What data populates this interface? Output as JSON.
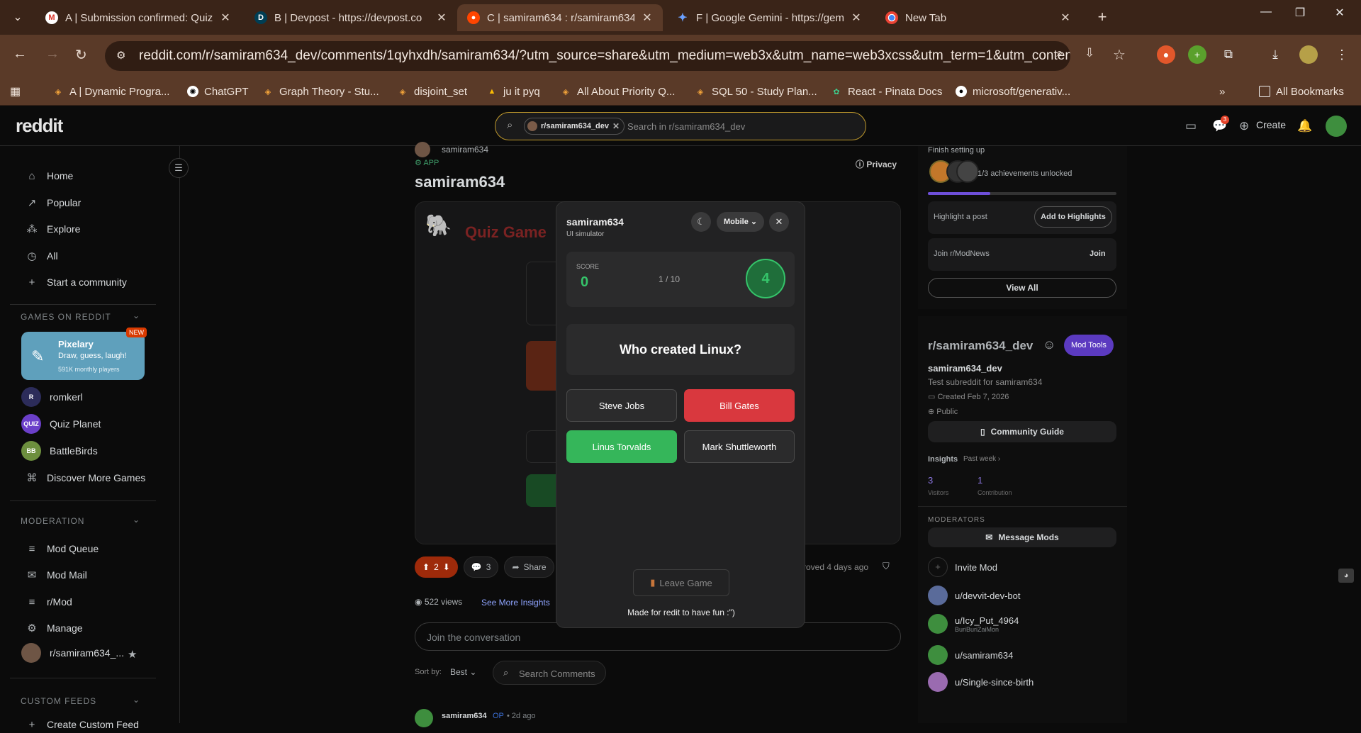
{
  "browser": {
    "tabs": [
      {
        "label": "A | Submission confirmed: Quiz",
        "icon": "gmail-icon"
      },
      {
        "label": "B | Devpost - https://devpost.co",
        "icon": "devpost-icon"
      },
      {
        "label": "C | samiram634 : r/samiram634",
        "icon": "reddit-icon"
      },
      {
        "label": "F | Google Gemini - https://gem",
        "icon": "gemini-icon"
      },
      {
        "label": "New Tab",
        "icon": "chrome-icon"
      }
    ],
    "url": "reddit.com/r/samiram634_dev/comments/1qyhxdh/samiram634/?utm_source=share&utm_medium=web3x&utm_name=web3xcss&utm_term=1&utm_content=sh...",
    "bookmarks": [
      "A | Dynamic Progra...",
      "ChatGPT",
      "Graph Theory - Stu...",
      "disjoint_set",
      "ju it pyq",
      "All About Priority Q...",
      "SQL 50 - Study Plan...",
      "React - Pinata Docs",
      "microsoft/generativ..."
    ],
    "all_bookmarks": "All Bookmarks"
  },
  "reddit": {
    "logo": "reddit",
    "search": {
      "chip": "r/samiram634_dev",
      "placeholder": "Search in r/samiram634_dev"
    },
    "create": "Create",
    "chat_badge": "3"
  },
  "left_nav": {
    "items": [
      "Home",
      "Popular",
      "Explore",
      "All"
    ],
    "start_community": "Start a community",
    "games_header": "GAMES ON REDDIT",
    "featured_game": {
      "name": "Pixelary",
      "tagline": "Draw, guess, laugh!",
      "players": "591K monthly players",
      "badge": "NEW"
    },
    "games": [
      "romkerl",
      "Quiz Planet",
      "BattleBirds"
    ],
    "discover": "Discover More Games",
    "moderation_header": "MODERATION",
    "mod_items": [
      "Mod Queue",
      "Mod Mail",
      "r/Mod",
      "Manage"
    ],
    "community": "r/samiram634_...",
    "custom_feeds_header": "CUSTOM FEEDS",
    "create_feed": "Create Custom Feed"
  },
  "post": {
    "author": "samiram634",
    "app_tag": "APP",
    "privacy": "Privacy",
    "title": "samiram634",
    "game_title": "Quiz Game",
    "votes": "2",
    "comments": "3",
    "share": "Share",
    "approved": "roved 4 days ago",
    "views": "522 views",
    "see_more": "See More Insights",
    "join_placeholder": "Join the conversation",
    "sort_label": "Sort by:",
    "sort_value": "Best",
    "search_comments": "Search Comments",
    "comment_author": "samiram634",
    "comment_op": "OP",
    "comment_time": "• 2d ago"
  },
  "modal": {
    "title": "samiram634",
    "subtitle": "UI simulator",
    "device": "Mobile",
    "score_label": "SCORE",
    "score": "0",
    "progress": "1 / 10",
    "timer": "4",
    "question": "Who created Linux?",
    "options": [
      {
        "label": "Steve Jobs",
        "state": "neutral"
      },
      {
        "label": "Bill Gates",
        "state": "wrong"
      },
      {
        "label": "Linus Torvalds",
        "state": "correct"
      },
      {
        "label": "Mark Shuttleworth",
        "state": "neutral"
      }
    ],
    "leave": "Leave Game",
    "footer": "Made for redit to have fun :\")"
  },
  "right": {
    "finish_setup": "Finish setting up",
    "achievements": "1/3 achievements unlocked",
    "achievement_progress": 0.33,
    "highlight": "Highlight a post",
    "add_highlights": "Add to Highlights",
    "join_modnews": "Join r/ModNews",
    "join": "Join",
    "view_all": "View All",
    "sub_name": "r/samiram634_dev",
    "mod_tools": "Mod Tools",
    "sub_title": "samiram634_dev",
    "sub_desc": "Test subreddit for samiram634",
    "created": "Created Feb 7, 2026",
    "visibility": "Public",
    "guide": "Community Guide",
    "insights": "Insights",
    "past_week": "Past week ›",
    "visitors": "3",
    "visitors_label": "Visitors",
    "contrib": "1",
    "contrib_label": "Contribution",
    "moderators": "MODERATORS",
    "message_mods": "Message Mods",
    "invite_mod": "Invite Mod",
    "mods": [
      {
        "name": "u/devvit-dev-bot",
        "flair": "",
        "color": "#5a6b9a"
      },
      {
        "name": "u/Icy_Put_4964",
        "flair": "BuriBuriZaiMon",
        "color": "#3e8e3e"
      },
      {
        "name": "u/samiram634",
        "flair": "",
        "color": "#3e8e3e"
      },
      {
        "name": "u/Single-since-birth",
        "flair": "",
        "color": "#9a6bb0"
      }
    ]
  }
}
